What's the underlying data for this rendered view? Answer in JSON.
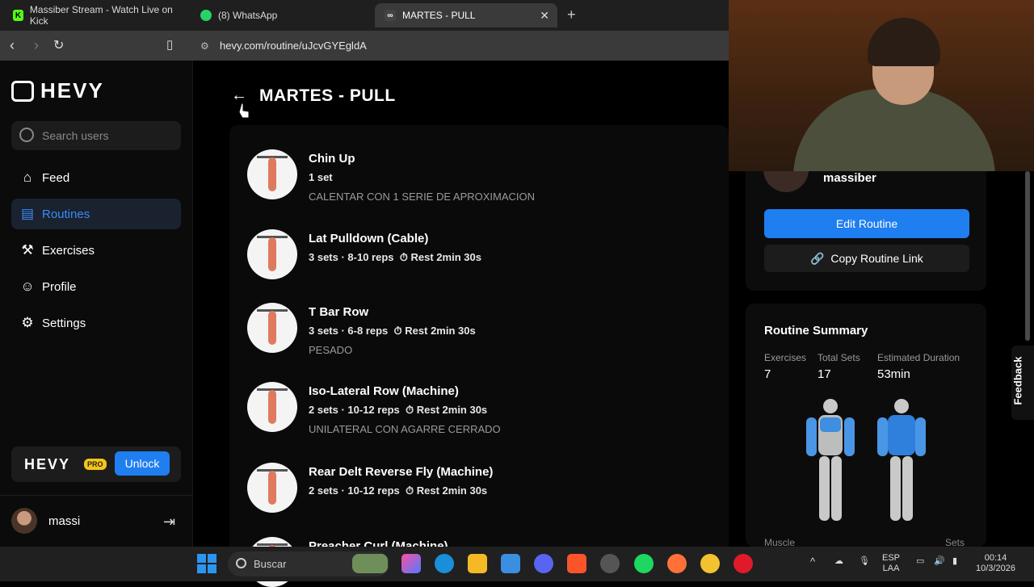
{
  "browser": {
    "tabs": [
      {
        "title": "Massiber Stream - Watch Live on Kick",
        "active": false
      },
      {
        "title": "(8) WhatsApp",
        "active": false
      },
      {
        "title": "MARTES - PULL",
        "active": true
      }
    ],
    "url": "hevy.com/routine/uJcvGYEgldA"
  },
  "sidebar": {
    "brand": "HEVY",
    "search_placeholder": "Search users",
    "items": [
      {
        "label": "Feed",
        "icon": "home-icon"
      },
      {
        "label": "Routines",
        "icon": "clipboard-icon",
        "active": true
      },
      {
        "label": "Exercises",
        "icon": "dumbbell-icon"
      },
      {
        "label": "Profile",
        "icon": "person-icon"
      },
      {
        "label": "Settings",
        "icon": "gear-icon"
      }
    ],
    "pro_brand": "HEVY",
    "pro_badge": "PRO",
    "unlock_label": "Unlock",
    "user_name": "massi"
  },
  "routine": {
    "title": "MARTES - PULL",
    "exercises": [
      {
        "name": "Chin Up",
        "meta": "1 set",
        "rest": "",
        "note": "CALENTAR CON 1 SERIE DE APROXIMACION"
      },
      {
        "name": "Lat Pulldown (Cable)",
        "meta": "3 sets · 8-10 reps",
        "rest": "Rest 2min 30s",
        "note": ""
      },
      {
        "name": "T Bar Row",
        "meta": "3 sets · 6-8 reps",
        "rest": "Rest 2min 30s",
        "note": "PESADO"
      },
      {
        "name": "Iso-Lateral Row (Machine)",
        "meta": "2 sets · 10-12 reps",
        "rest": "Rest 2min 30s",
        "note": "UNILATERAL CON AGARRE CERRADO"
      },
      {
        "name": "Rear Delt Reverse Fly (Machine)",
        "meta": "2 sets · 10-12 reps",
        "rest": "Rest 2min 30s",
        "note": ""
      },
      {
        "name": "Preacher Curl (Machine)",
        "meta": "",
        "rest": "",
        "note": ""
      }
    ]
  },
  "right": {
    "owner": "massiber",
    "edit_label": "Edit Routine",
    "copy_label": "Copy Routine Link",
    "summary_title": "Routine Summary",
    "stats": [
      {
        "label": "Exercises",
        "value": "7"
      },
      {
        "label": "Total Sets",
        "value": "17"
      },
      {
        "label": "Estimated Duration",
        "value": "53min"
      }
    ],
    "muscle_label": "Muscle",
    "sets_label": "Sets",
    "feedback": "Feedback"
  },
  "taskbar": {
    "search": "Buscar",
    "lang_top": "ESP",
    "lang_bottom": "LAA",
    "time": "00:14",
    "date": "10/3/2026"
  },
  "colors": {
    "accent": "#1f7ef0",
    "active_nav": "#3b8cf5"
  }
}
